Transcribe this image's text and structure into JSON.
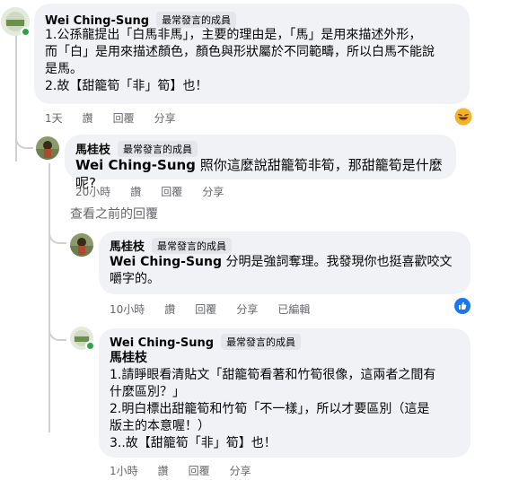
{
  "c1": {
    "author": "Wei Ching-Sung",
    "badge": "最常發言的成員",
    "text1": "1.公孫龍提出「白馬非馬」，主要的理由是，「馬」是用來描述外形，",
    "text2": "而「白」是用來描述顏色，顏色與形狀屬於不同範疇，所以白馬不能說",
    "text3": "是馬。",
    "text4": "2.故【甜籠筍「非」筍】也！",
    "time": "1天",
    "read": "讚",
    "reply": "回覆",
    "share": "分享",
    "reaction_icon": "haha-emoji"
  },
  "c2": {
    "author": "馬桂枝",
    "badge": "最常發言的成員",
    "mention": "Wei Ching-Sung",
    "text": " 照你這麼說甜籠筍非筍，那甜籠筍是什麼呢?",
    "time": "20小時",
    "read": "讚",
    "reply": "回覆",
    "share": "分享"
  },
  "view_previous": "查看之前的回覆",
  "c3": {
    "author": "馬桂枝",
    "badge": "最常發言的成員",
    "mention": "Wei Ching-Sung",
    "text1": " 分明是強詞奪理。我發現你也挺喜歡咬文",
    "text2": "嚼字的。",
    "time": "10小時",
    "read": "讚",
    "reply": "回覆",
    "share": "分享",
    "edited": "已編輯",
    "reaction_icon": "like-icon"
  },
  "c4": {
    "author": "Wei Ching-Sung",
    "badge": "最常發言的成員",
    "mention": "馬桂枝",
    "text1": "1.請睜眼看清貼文「甜籠筍看著和竹筍很像，這兩者之間有",
    "text2": "什麼區別？」",
    "text3": "2.明白標出甜籠筍和竹筍「不一樣」，所以才要區別（這是",
    "text4": "版主的本意喔！）",
    "text5": "3..故【甜籠筍「非」筍】也！",
    "time": "1小時",
    "read": "讚",
    "reply": "回覆",
    "share": "分享"
  }
}
